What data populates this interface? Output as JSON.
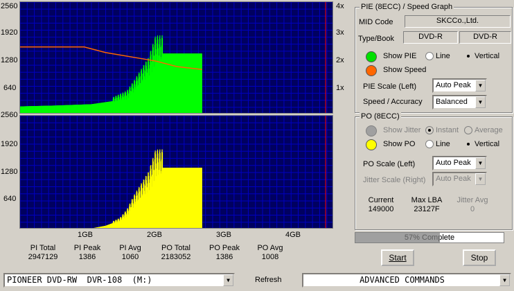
{
  "pie_graph": {
    "y_ticks": [
      "2560",
      "1920",
      "1280",
      "640"
    ],
    "right_ticks": [
      "4x",
      "3x",
      "2x",
      "1x"
    ]
  },
  "po_graph": {
    "y_ticks": [
      "2560",
      "1920",
      "1280",
      "640"
    ]
  },
  "x_ticks": [
    "1GB",
    "2GB",
    "3GB",
    "4GB"
  ],
  "chart_data": [
    {
      "type": "area",
      "name": "PIE (8ECC)",
      "x_unit": "GB",
      "xlim": [
        0,
        4.4
      ],
      "ylim": [
        0,
        2560
      ],
      "y_ticks": [
        640,
        1280,
        1920,
        2560
      ],
      "x_ticks": [
        "1GB",
        "2GB",
        "3GB",
        "4GB"
      ],
      "series": [
        {
          "name": "PIE",
          "color": "#00ff00",
          "x": [
            0,
            0.5,
            1.0,
            1.3,
            1.5,
            1.6,
            1.7,
            1.8,
            1.9,
            2.0,
            2.3,
            2.55
          ],
          "values": [
            180,
            200,
            230,
            300,
            420,
            600,
            800,
            1000,
            1386,
            1386,
            1386,
            1386
          ]
        },
        {
          "name": "Speed",
          "color": "#ff6600",
          "axis": "right",
          "unit": "x",
          "x": [
            0,
            0.9,
            1.2,
            1.9,
            2.2,
            2.55
          ],
          "values": [
            2.4,
            2.4,
            2.2,
            1.9,
            1.7,
            1.6
          ]
        }
      ]
    },
    {
      "type": "area",
      "name": "PO (8ECC)",
      "x_unit": "GB",
      "xlim": [
        0,
        4.4
      ],
      "ylim": [
        0,
        2560
      ],
      "y_ticks": [
        640,
        1280,
        1920,
        2560
      ],
      "x_ticks": [
        "1GB",
        "2GB",
        "3GB",
        "4GB"
      ],
      "series": [
        {
          "name": "PO",
          "color": "#ffff00",
          "x": [
            0,
            0.8,
            1.0,
            1.2,
            1.4,
            1.5,
            1.6,
            1.7,
            1.8,
            1.9,
            2.0,
            2.55
          ],
          "values": [
            0,
            0,
            20,
            80,
            200,
            350,
            600,
            800,
            1000,
            1386,
            1386,
            1386
          ]
        }
      ]
    }
  ],
  "stats": [
    {
      "label": "PI Total",
      "value": "2947129"
    },
    {
      "label": "PI Peak",
      "value": "1386"
    },
    {
      "label": "PI Avg",
      "value": "1060"
    },
    {
      "label": "PO Total",
      "value": "2183052"
    },
    {
      "label": "PO Peak",
      "value": "1386"
    },
    {
      "label": "PO Avg",
      "value": "1008"
    }
  ],
  "pie_panel": {
    "title": "PIE (8ECC) / Speed Graph",
    "mid_label": "MID Code",
    "mid_value": "SKCCo.,Ltd.",
    "type_label": "Type/Book",
    "type_value": "DVD-R",
    "book_value": "DVD-R",
    "show_pie": "Show PIE",
    "show_speed": "Show Speed",
    "line": "Line",
    "vertical": "Vertical",
    "pie_scale_label": "PIE Scale (Left)",
    "pie_scale_value": "Auto Peak",
    "speed_label": "Speed / Accuracy",
    "speed_value": "Balanced",
    "pie_color": "#00e000",
    "speed_color": "#ff6600"
  },
  "po_panel": {
    "title": "PO (8ECC)",
    "show_jitter": "Show Jitter",
    "instant": "Instant",
    "average": "Average",
    "show_po": "Show PO",
    "line": "Line",
    "vertical": "Vertical",
    "po_scale_label": "PO Scale (Left)",
    "po_scale_value": "Auto Peak",
    "jitter_scale_label": "Jitter Scale (Right)",
    "jitter_scale_value": "Auto Peak",
    "current_label": "Current",
    "current_value": "149000",
    "maxlba_label": "Max LBA",
    "maxlba_value": "23127F",
    "jitter_avg_label": "Jitter Avg",
    "jitter_avg_value": "0",
    "po_color": "#ffff00"
  },
  "progress": {
    "text": "57% Complete",
    "percent": 57
  },
  "buttons": {
    "start": "Start",
    "stop": "Stop"
  },
  "drive": {
    "value": "PIONEER DVD-RW  DVR-108  (M:)"
  },
  "refresh": "Refresh",
  "commands": {
    "value": "ADVANCED COMMANDS"
  }
}
